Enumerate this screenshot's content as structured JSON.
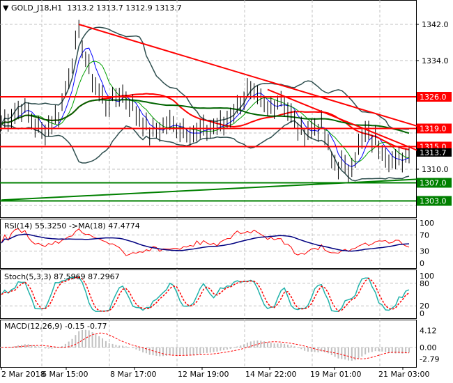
{
  "header": {
    "symbol": "GOLD_J18,H1",
    "open": "1313.2",
    "high": "1313.7",
    "low": "1312.9",
    "close": "1313.7"
  },
  "indicators": {
    "rsi": "RSI(14) 55.3250  ->MA(18) 47.4774",
    "stoch": "Stoch(5,3,3) 87.5969 87.2967",
    "macd": "MACD(12,26,9) -0.15 -0.77"
  },
  "colors": {
    "red": "#ff0000",
    "green": "#008000",
    "band": "#2f4f4f",
    "rsi": "#ff0000",
    "rsiMa": "#000080",
    "stochMain": "#20b2aa",
    "stochSig": "#ff0000",
    "macdHist": "#c0c0c0"
  },
  "chart_data": {
    "type": "line",
    "title": "GOLD_J18,H1",
    "price_axis": {
      "ticks": [
        "1342.0",
        "1334.0",
        "1310.0"
      ],
      "range": [
        1300,
        1347
      ]
    },
    "levels": [
      {
        "label": "1326.0",
        "price": 1326,
        "color": "red"
      },
      {
        "label": "1319.0",
        "price": 1319,
        "color": "red"
      },
      {
        "label": "1315.0",
        "price": 1315,
        "color": "red"
      },
      {
        "label": "1307.0",
        "price": 1307,
        "color": "green"
      },
      {
        "label": "1303.0",
        "price": 1303,
        "color": "green"
      }
    ],
    "current_price": "1313.7",
    "trendlines": [
      {
        "color": "red",
        "from": [
          23,
          1342
        ],
        "to": [
          124,
          1319.4
        ]
      },
      {
        "color": "red",
        "from": [
          79,
          1327.6
        ],
        "to": [
          124,
          1314
        ]
      },
      {
        "color": "green",
        "from": [
          0,
          1303.2
        ],
        "to": [
          124,
          1307.8
        ]
      }
    ],
    "close_keypoints": [
      [
        0,
        1320
      ],
      [
        6,
        1324
      ],
      [
        12,
        1318
      ],
      [
        17,
        1322
      ],
      [
        23,
        1340
      ],
      [
        26,
        1332
      ],
      [
        31,
        1324
      ],
      [
        36,
        1327
      ],
      [
        44,
        1318
      ],
      [
        50,
        1320
      ],
      [
        58,
        1318
      ],
      [
        66,
        1320
      ],
      [
        73,
        1327
      ],
      [
        79,
        1323
      ],
      [
        83,
        1326
      ],
      [
        89,
        1318
      ],
      [
        95,
        1320
      ],
      [
        98,
        1312
      ],
      [
        103,
        1310
      ],
      [
        108,
        1318
      ],
      [
        113,
        1315
      ],
      [
        117,
        1311
      ],
      [
        121,
        1313.7
      ]
    ],
    "bars": 122,
    "time_labels": [
      "2 Mar 2018",
      "6 Mar 15:00",
      "8 Mar 17:00",
      "12 Mar 19:00",
      "14 Mar 22:00",
      "19 Mar 01:00",
      "21 Mar 03:00"
    ],
    "rsi_axis": [
      "100",
      "70",
      "30",
      "0"
    ],
    "stoch_axis": [
      "100",
      "80",
      "20",
      "0"
    ],
    "macd_axis": [
      "4.12",
      "0.00",
      "-2.79"
    ]
  }
}
